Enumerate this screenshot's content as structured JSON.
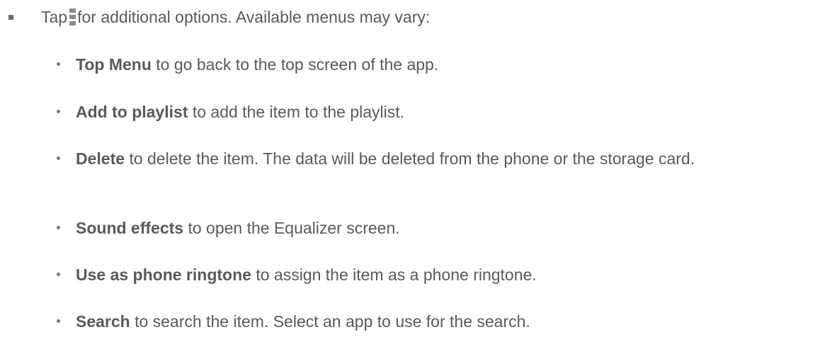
{
  "main": {
    "text_before": "Tap",
    "icon": "menu-icon",
    "text_after": "for additional options. Available menus may vary:"
  },
  "options": [
    {
      "term": "Top Menu",
      "description": "to go back to the top screen of the app."
    },
    {
      "term": "Add to playlist",
      "description": "to add the item to the playlist."
    },
    {
      "term": "Delete",
      "description": "to delete the item. The data will be deleted from the phone or the storage card."
    },
    {
      "term": "Sound effects",
      "description": "to open the Equalizer screen."
    },
    {
      "term": "Use as phone ringtone",
      "description": "to assign the item as a phone ringtone."
    },
    {
      "term": "Search",
      "description": "to search the item. Select an app to use for the search."
    }
  ]
}
